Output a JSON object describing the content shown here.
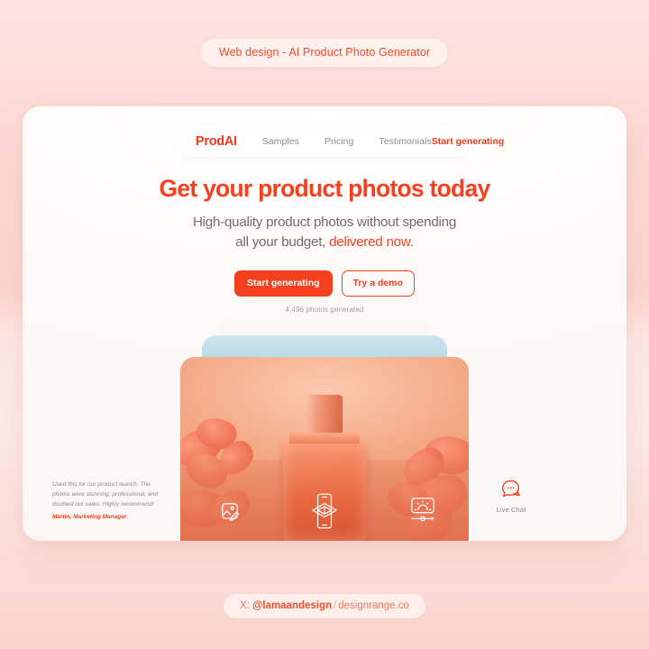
{
  "top_badge": {
    "label": "Web design - AI Product Photo Generator"
  },
  "nav": {
    "brand": "ProdAI",
    "links": [
      {
        "label": "Samples"
      },
      {
        "label": "Pricing"
      },
      {
        "label": "Testimonials"
      }
    ],
    "cta": "Start generating"
  },
  "hero": {
    "headline": "Get your product photos today",
    "subhead_line1": "High-quality product photos without spending",
    "subhead_line2_plain": "all your budget, ",
    "subhead_line2_accent": "delivered now.",
    "primary_button": "Start generating",
    "secondary_button": "Try a demo",
    "note": "4,496 photos generated"
  },
  "image_stack": {
    "icons": [
      {
        "name": "image-edit-icon"
      },
      {
        "name": "ar-phone-cube-icon"
      },
      {
        "name": "brightness-slider-icon"
      }
    ]
  },
  "testimonial": {
    "quote": "Used this for our product launch. The photos were stunning, professional, and doubled our sales. Highly recommend!",
    "author": "Martin, Marketing Manager"
  },
  "live_chat": {
    "label": "Live Chat",
    "icon": "chat-bubble-icon"
  },
  "footer": {
    "prefix": "X: ",
    "handle": "@lamaandesign",
    "separator": "/",
    "site": "designrange.co"
  },
  "colors": {
    "accent": "#f4401f",
    "background_pink": "#fdd9d5",
    "card_white": "#fcfaf9",
    "muted_text": "#8a8786"
  }
}
